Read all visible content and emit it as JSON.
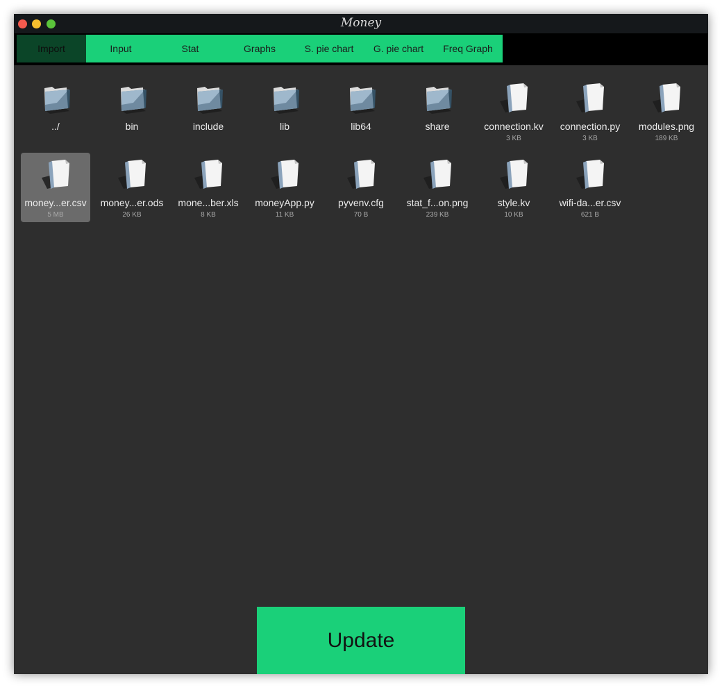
{
  "window": {
    "title": "Money"
  },
  "tabs": [
    {
      "label": "Import"
    },
    {
      "label": "Input"
    },
    {
      "label": "Stat"
    },
    {
      "label": "Graphs"
    },
    {
      "label": "S. pie chart"
    },
    {
      "label": "G. pie chart"
    },
    {
      "label": "Freq Graph"
    }
  ],
  "files": [
    {
      "name": "../",
      "size": "",
      "kind": "folder"
    },
    {
      "name": "bin",
      "size": "",
      "kind": "folder"
    },
    {
      "name": "include",
      "size": "",
      "kind": "folder"
    },
    {
      "name": "lib",
      "size": "",
      "kind": "folder"
    },
    {
      "name": "lib64",
      "size": "",
      "kind": "folder"
    },
    {
      "name": "share",
      "size": "",
      "kind": "folder"
    },
    {
      "name": "connection.kv",
      "size": "3 KB",
      "kind": "file"
    },
    {
      "name": "connection.py",
      "size": "3 KB",
      "kind": "file"
    },
    {
      "name": "modules.png",
      "size": "189 KB",
      "kind": "file"
    },
    {
      "name": "money...er.csv",
      "size": "5 MB",
      "kind": "file"
    },
    {
      "name": "money...er.ods",
      "size": "26 KB",
      "kind": "file"
    },
    {
      "name": "mone...ber.xls",
      "size": "8 KB",
      "kind": "file"
    },
    {
      "name": "moneyApp.py",
      "size": "11 KB",
      "kind": "file"
    },
    {
      "name": "pyvenv.cfg",
      "size": "70 B",
      "kind": "file"
    },
    {
      "name": "stat_f...on.png",
      "size": "239 KB",
      "kind": "file"
    },
    {
      "name": "style.kv",
      "size": "10 KB",
      "kind": "file"
    },
    {
      "name": "wifi-da...er.csv",
      "size": "621 B",
      "kind": "file"
    }
  ],
  "update_button": {
    "label": "Update"
  },
  "colors": {
    "accent": "#1ad079",
    "active_tab": "#0b4528",
    "panel": "#2e2e2e",
    "selection": "#6b6b6b"
  }
}
